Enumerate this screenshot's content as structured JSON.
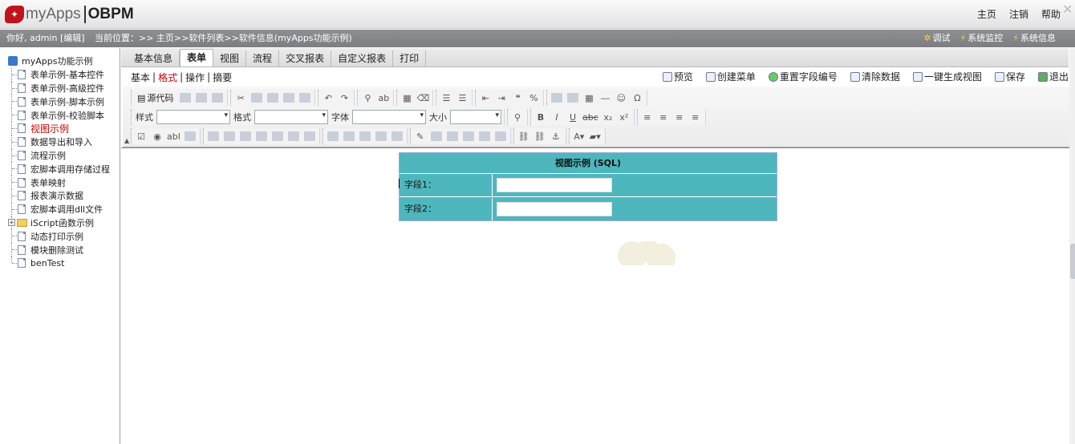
{
  "header": {
    "brand_mark": "myApps",
    "brand_left": "myApps",
    "brand_right": "OBPM",
    "nav": [
      "主页",
      "注销",
      "帮助"
    ]
  },
  "status": {
    "greeting": "你好, admin [编辑]",
    "breadcrumb": "当前位置：>> 主页>>软件列表>>软件信息(myApps功能示例)",
    "right": [
      "调试",
      "系统监控",
      "系统信息"
    ]
  },
  "sidebar": {
    "root": "myApps功能示例",
    "items": [
      "表单示例-基本控件",
      "表单示例-高级控件",
      "表单示例-脚本示例",
      "表单示例-校验脚本",
      "视图示例",
      "数据导出和导入",
      "流程示例",
      "宏脚本调用存储过程",
      "表单映射",
      "报表演示数据",
      "宏脚本调用dll文件",
      "iScript函数示例",
      "动态打印示例",
      "模块删除测试",
      "benTest"
    ],
    "active_index": 4
  },
  "tabs": [
    "基本信息",
    "表单",
    "视图",
    "流程",
    "交叉报表",
    "自定义报表",
    "打印"
  ],
  "active_tab": "表单",
  "subtabs": [
    "基本",
    "格式",
    "操作",
    "摘要"
  ],
  "active_subtab": "格式",
  "actions": [
    "预览",
    "创建菜单",
    "重置字段编号",
    "清除数据",
    "一键生成视图",
    "保存",
    "退出"
  ],
  "toolbar": {
    "source_label": "源代码",
    "style_label": "样式",
    "format_label": "格式",
    "font_label": "字体",
    "size_label": "大小"
  },
  "form": {
    "title": "视图示例 (SQL)",
    "field1_label": "字段1：",
    "field2_label": "字段2："
  },
  "colors": {
    "status_bar": "#84868a",
    "form_bg": "#4eb7bd",
    "active_red": "#cc0000"
  }
}
